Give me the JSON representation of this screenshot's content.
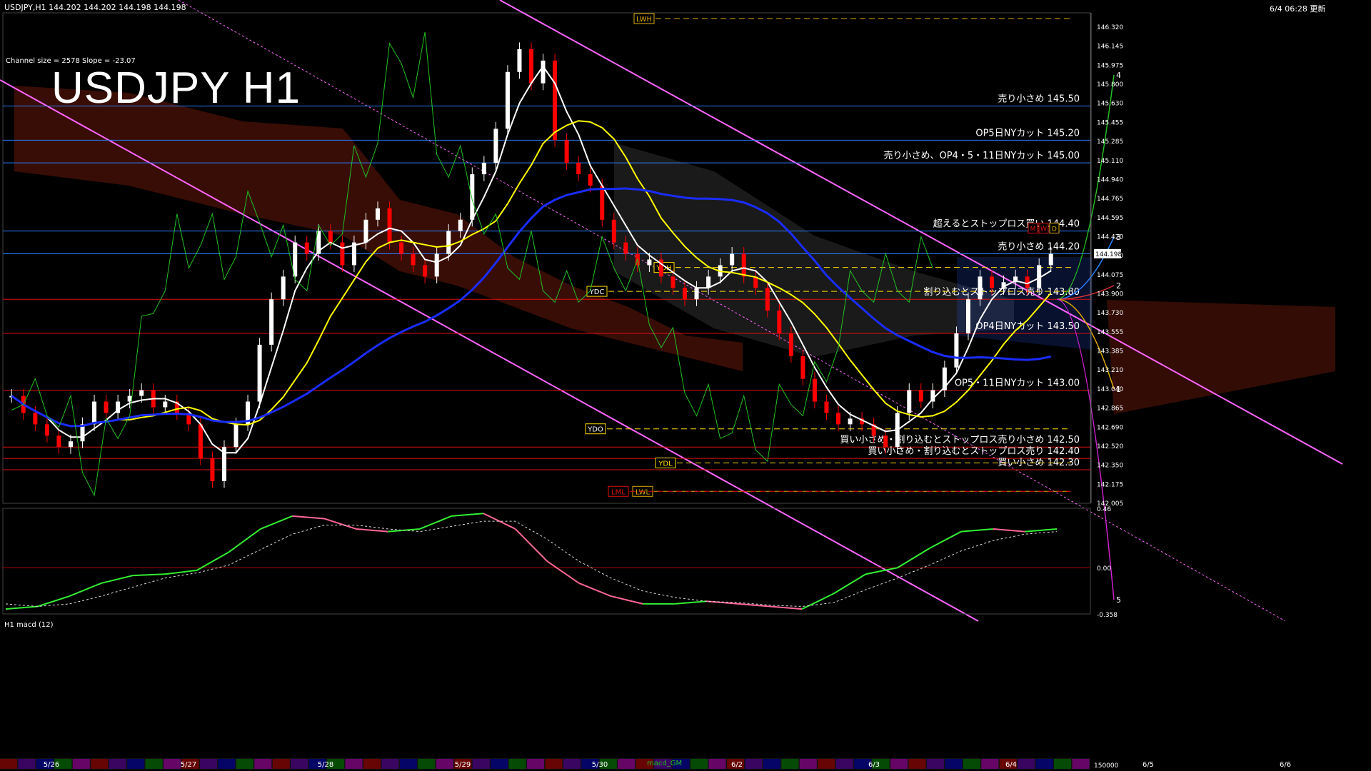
{
  "header": {
    "symbol_info": "USDJPY,H1  144.202 144.202 144.198 144.198",
    "updated": "6/4 06:28 更新",
    "channel_info": "Channel size = 2578 Slope = -23.07",
    "big_title": "USDJPY H1",
    "subwindow_label": "H1  macd (12)",
    "macd_tag": "macd_GM"
  },
  "colors": {
    "background": "#000000",
    "bull_candle": "#ffffff",
    "bear_candle": "#ff0000",
    "channel": "#ff66ff",
    "ma_white": "#ffffff",
    "ma_yellow": "#ffff00",
    "ma_blue": "#1a2cff",
    "chikou": "#22c022",
    "cloud_red": "#ff3a1a",
    "cloud_white": "#cccccc",
    "level_blue": "#2a7fff",
    "level_red": "#dd1010",
    "macd_green": "#33ee33",
    "macd_pink": "#ff6699"
  },
  "chart_data": [
    {
      "type": "line",
      "name": "USDJPY H1 price",
      "ylim": [
        142.005,
        146.32
      ],
      "y_ticks": [
        "146.320",
        "146.145",
        "145.975",
        "145.800",
        "145.630",
        "145.455",
        "145.285",
        "145.110",
        "144.940",
        "144.765",
        "144.595",
        "144.420",
        "144.250",
        "144.075",
        "143.900",
        "143.730",
        "143.555",
        "143.385",
        "143.210",
        "143.040",
        "142.865",
        "142.690",
        "142.520",
        "142.350",
        "142.175",
        "142.005"
      ],
      "x_dates": [
        "5/26",
        "5/27",
        "5/28",
        "5/29",
        "5/30",
        "6/2",
        "6/3",
        "6/4",
        "6/5",
        "6/6"
      ],
      "current_price": "144.198",
      "close_series": [
        142.95,
        142.8,
        142.7,
        142.6,
        142.5,
        142.55,
        142.7,
        142.9,
        142.8,
        142.9,
        142.95,
        143.0,
        142.85,
        142.9,
        142.8,
        142.7,
        142.4,
        142.2,
        142.5,
        142.7,
        142.9,
        143.4,
        143.8,
        144.0,
        144.3,
        144.2,
        144.4,
        144.3,
        144.1,
        144.3,
        144.5,
        144.6,
        144.3,
        144.2,
        144.1,
        144.0,
        144.2,
        144.4,
        144.5,
        144.9,
        145.0,
        145.3,
        145.8,
        146.0,
        145.7,
        145.9,
        145.2,
        145.0,
        144.9,
        144.8,
        144.5,
        144.3,
        144.2,
        144.1,
        144.15,
        144.0,
        143.9,
        143.8,
        143.9,
        144.0,
        144.1,
        144.2,
        144.0,
        143.9,
        143.7,
        143.5,
        143.3,
        143.1,
        142.9,
        142.8,
        142.7,
        142.75,
        142.7,
        142.6,
        142.5,
        142.8,
        143.0,
        142.9,
        143.0,
        143.2,
        143.5,
        143.8,
        144.0,
        143.9,
        143.95,
        144.0,
        143.9,
        144.1,
        144.2
      ],
      "levels": [
        {
          "label": "売り小さめ 145.50",
          "value": 145.5,
          "color": "#2a7fff"
        },
        {
          "label": "OP5日NYカット 145.20",
          "value": 145.2,
          "color": "#2a7fff"
        },
        {
          "label": "売り小さめ、OP4・5・11日NYカット 145.00",
          "value": 145.0,
          "color": "#2a7fff"
        },
        {
          "label": "超えるとストップロス買い 144.40",
          "value": 144.4,
          "color": "#2a7fff"
        },
        {
          "label": "売り小さめ 144.20",
          "value": 144.2,
          "color": "#2a7fff"
        },
        {
          "label": "割り込むとストップロス売り 143.80",
          "value": 143.8,
          "color": "#dd1010"
        },
        {
          "label": "OP4日NYカット 143.50",
          "value": 143.5,
          "color": "#dd1010"
        },
        {
          "label": "OP5・11日NYカット 143.00",
          "value": 143.0,
          "color": "#dd1010"
        },
        {
          "label": "買い小さめ・割り込むとストップロス売り小さめ 142.50",
          "value": 142.5,
          "color": "#dd1010"
        },
        {
          "label": "買い小さめ・割り込むとストップロス売り 142.40",
          "value": 142.4,
          "color": "#dd1010"
        },
        {
          "label": "買い小さめ 142.30",
          "value": 142.3,
          "color": "#dd1010"
        }
      ],
      "tags": [
        {
          "label": "LWH",
          "value": 146.27
        },
        {
          "label": "YDH",
          "value": 144.08
        },
        {
          "label": "YDC",
          "value": 143.87
        },
        {
          "label": "YDO",
          "value": 142.66
        },
        {
          "label": "YDL",
          "value": 142.36
        },
        {
          "label": "LWL",
          "value": 142.11
        },
        {
          "label": "LML",
          "value": 142.11
        }
      ],
      "projection_labels": [
        "4",
        "3",
        "2",
        "1",
        "5"
      ],
      "box_tags": [
        "M",
        "W",
        "D"
      ]
    },
    {
      "type": "line",
      "name": "macd (12)",
      "ylim": [
        -0.358,
        0.46
      ],
      "y_ticks": [
        "0.46",
        "0.00",
        "-0.358"
      ],
      "bottom_label": "150000",
      "series": [
        {
          "name": "macd",
          "values": [
            -0.32,
            -0.3,
            -0.22,
            -0.12,
            -0.06,
            -0.05,
            -0.02,
            0.12,
            0.3,
            0.4,
            0.38,
            0.3,
            0.28,
            0.3,
            0.4,
            0.42,
            0.3,
            0.05,
            -0.12,
            -0.22,
            -0.28,
            -0.28,
            -0.26,
            -0.28,
            -0.3,
            -0.32,
            -0.2,
            -0.05,
            0.0,
            0.15,
            0.28,
            0.3,
            0.28,
            0.3
          ]
        },
        {
          "name": "signal",
          "values": [
            -0.28,
            -0.3,
            -0.28,
            -0.22,
            -0.15,
            -0.08,
            -0.04,
            0.02,
            0.14,
            0.26,
            0.33,
            0.33,
            0.3,
            0.28,
            0.32,
            0.36,
            0.36,
            0.22,
            0.05,
            -0.08,
            -0.18,
            -0.23,
            -0.26,
            -0.27,
            -0.29,
            -0.3,
            -0.27,
            -0.17,
            -0.08,
            0.02,
            0.13,
            0.21,
            0.26,
            0.28
          ]
        }
      ]
    }
  ]
}
